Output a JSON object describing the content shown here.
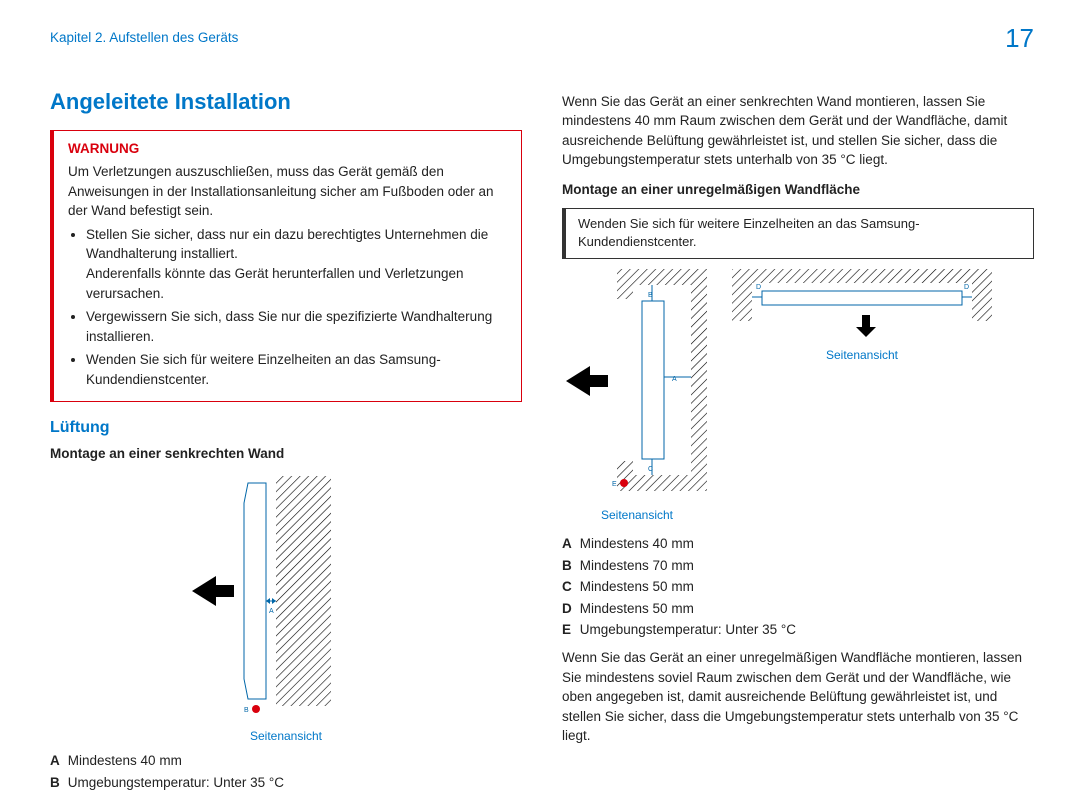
{
  "header": {
    "chapter": "Kapitel 2. Aufstellen des Geräts",
    "page": "17"
  },
  "left": {
    "title": "Angeleitete Installation",
    "warn": {
      "label": "WARNUNG",
      "intro": "Um Verletzungen auszuschließen, muss das Gerät gemäß den Anweisungen in der Installationsanleitung sicher am Fußboden oder an der Wand befestigt sein.",
      "b1": "Stellen Sie sicher, dass nur ein dazu berechtigtes Unternehmen die Wandhalterung installiert.",
      "b1b": "Anderenfalls könnte das Gerät herunterfallen und Verletzungen verursachen.",
      "b2": "Vergewissern Sie sich, dass Sie nur die spezifizierte Wandhalterung installieren.",
      "b3": "Wenden Sie sich für weitere Einzelheiten an das Samsung-Kundendienstcenter."
    },
    "vent": "Lüftung",
    "mount_perp": "Montage an einer senkrechten Wand",
    "caption": "Seitenansicht",
    "legA": "Mindestens 40 mm",
    "legB": "Umgebungstemperatur: Unter 35 °C",
    "labA": "A",
    "labB": "B"
  },
  "right": {
    "intro": "Wenn Sie das Gerät an einer senkrechten Wand montieren, lassen Sie mindestens 40 mm Raum zwischen dem Gerät und der Wandfläche, damit ausreichende Belüftung gewährleistet ist, und stellen Sie sicher, dass die Umgebungstemperatur stets unterhalb von 35 °C liegt.",
    "mount_irr": "Montage an einer unregelmäßigen Wandfläche",
    "info": "Wenden Sie sich für weitere Einzelheiten an das Samsung-Kundendienstcenter.",
    "capSide": "Seitenansicht",
    "legA": "Mindestens 40 mm",
    "legB": "Mindestens 70 mm",
    "legC": "Mindestens 50 mm",
    "legD": "Mindestens 50 mm",
    "legE": "Umgebungstemperatur: Unter 35 °C",
    "labA": "A",
    "labB": "B",
    "labC": "C",
    "labD": "D",
    "labE": "E",
    "outro": "Wenn Sie das Gerät an einer unregelmäßigen Wandfläche montieren, lassen Sie mindestens soviel Raum zwischen dem Gerät und der Wandfläche, wie oben angegeben ist, damit ausreichende Belüftung gewährleistet ist, und stellen Sie sicher, dass die Umgebungstemperatur stets unterhalb von 35 °C liegt."
  }
}
